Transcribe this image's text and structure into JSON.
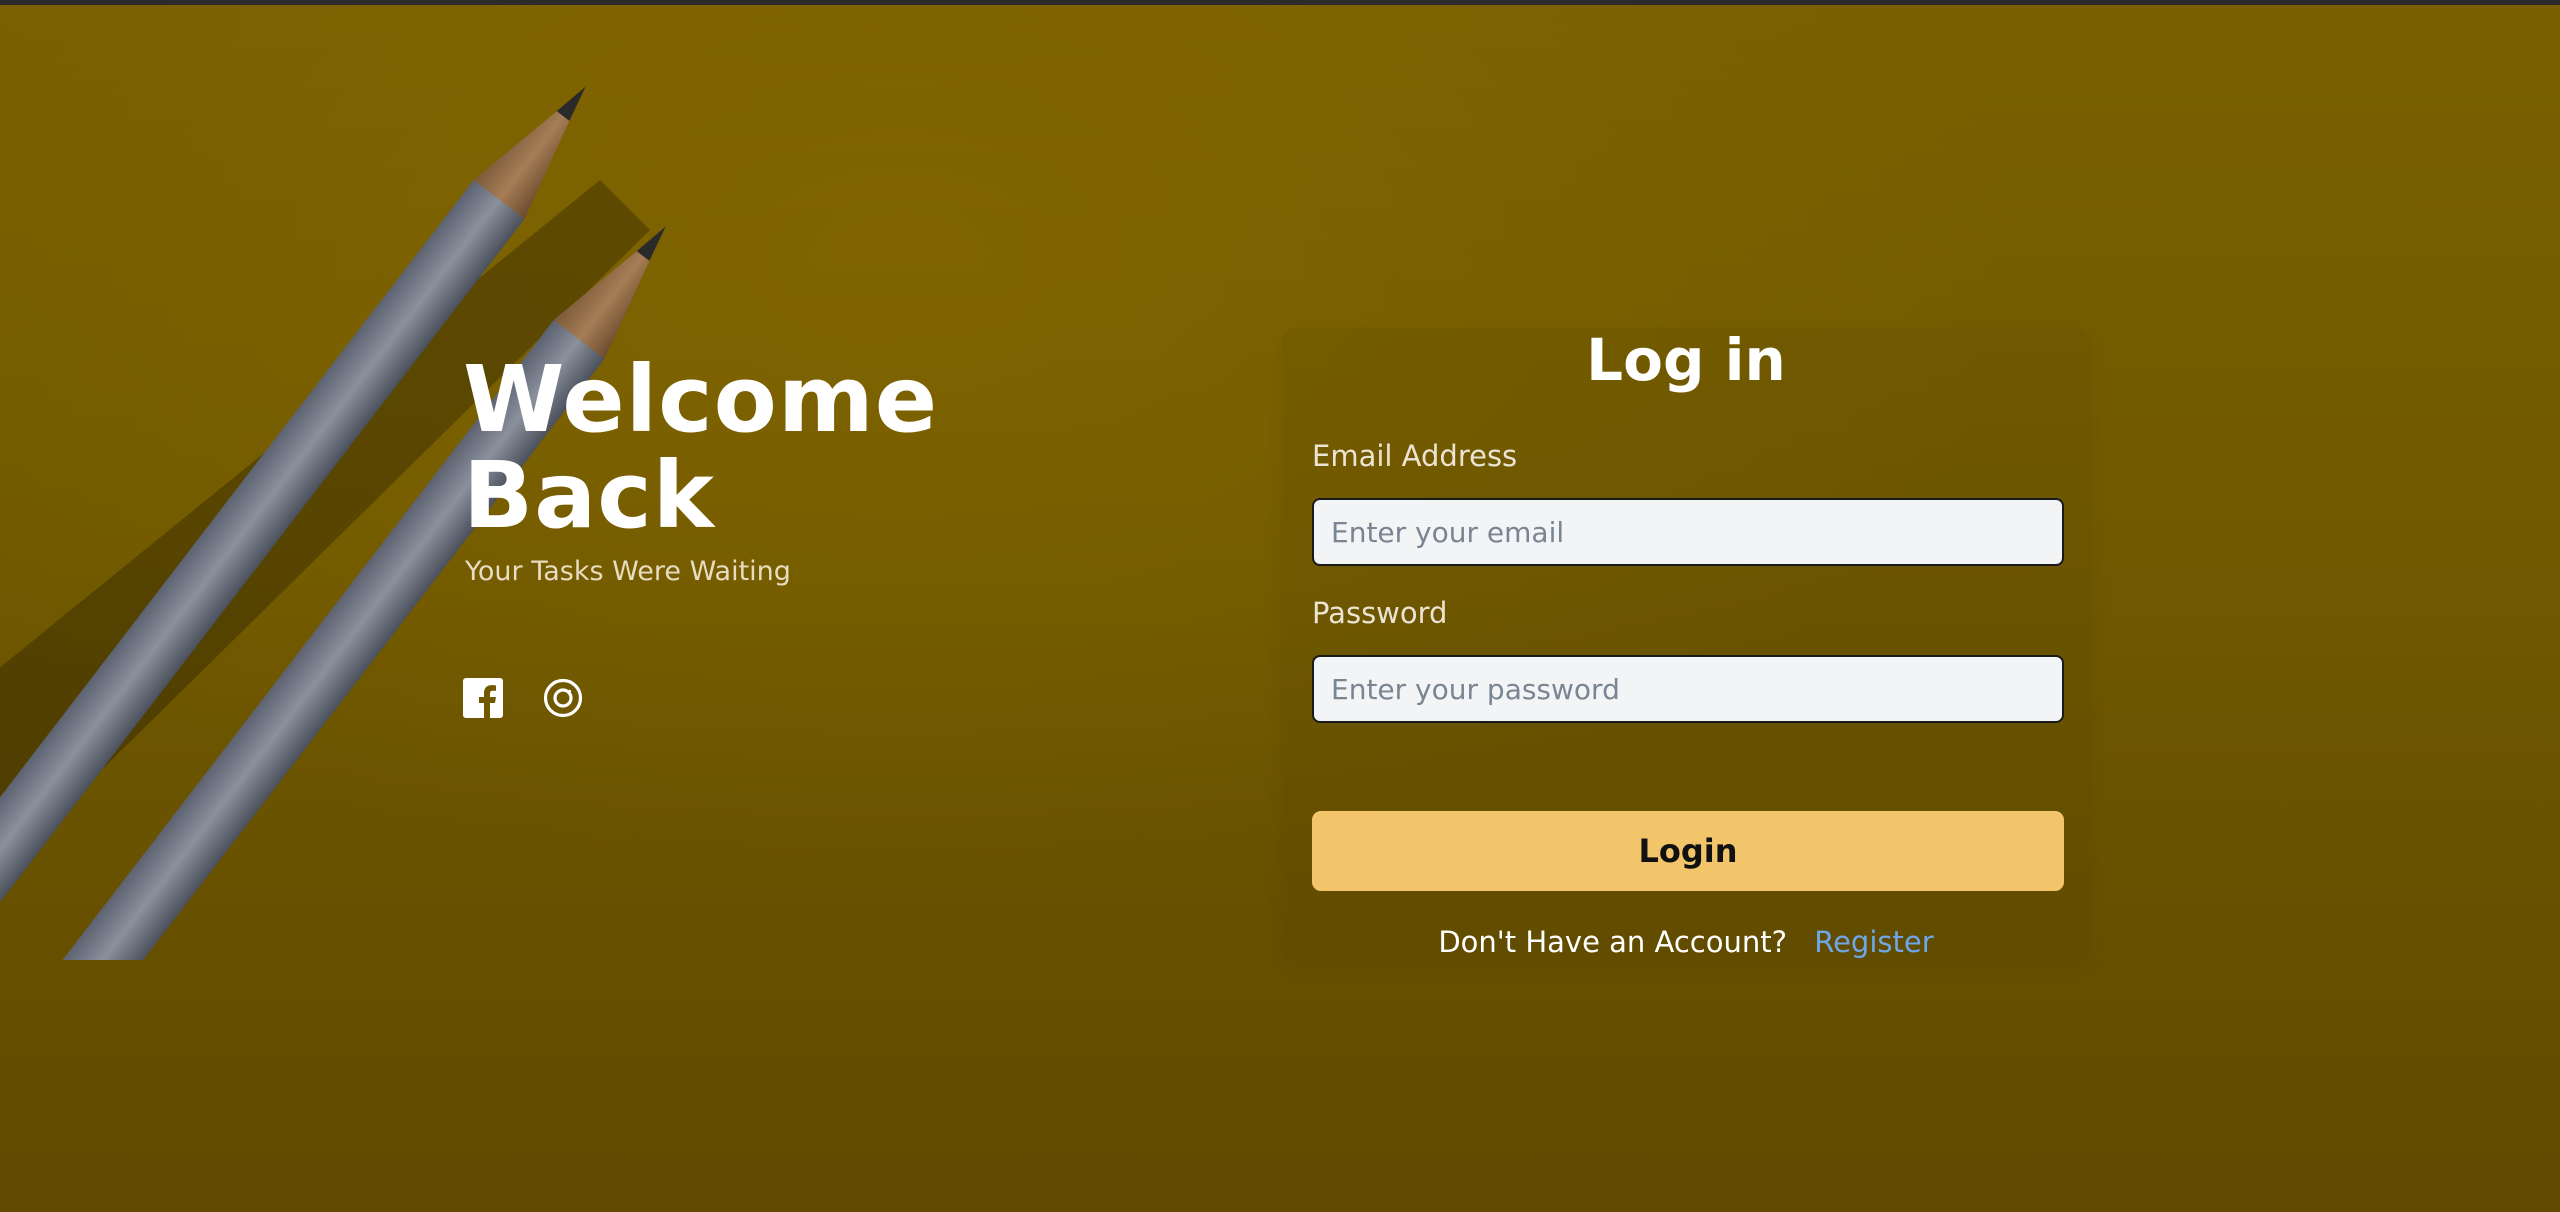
{
  "hero": {
    "title_line1": "Welcome",
    "title_line2": "Back",
    "subtitle": "Your Tasks Were Waiting"
  },
  "socials": [
    {
      "icon": "facebook-icon"
    },
    {
      "icon": "instagram-icon"
    }
  ],
  "login": {
    "title": "Log in",
    "email_label": "Email Address",
    "email_placeholder": "Enter your email",
    "email_value": "",
    "password_label": "Password",
    "password_placeholder": "Enter your password",
    "password_value": "",
    "button_label": "Login",
    "register_prompt": "Don't Have an Account?",
    "register_link": "Register"
  },
  "colors": {
    "background": "#725900",
    "accent_button": "#F3C56A",
    "link": "#6FA6E8",
    "input_bg": "#F3F4F6"
  }
}
